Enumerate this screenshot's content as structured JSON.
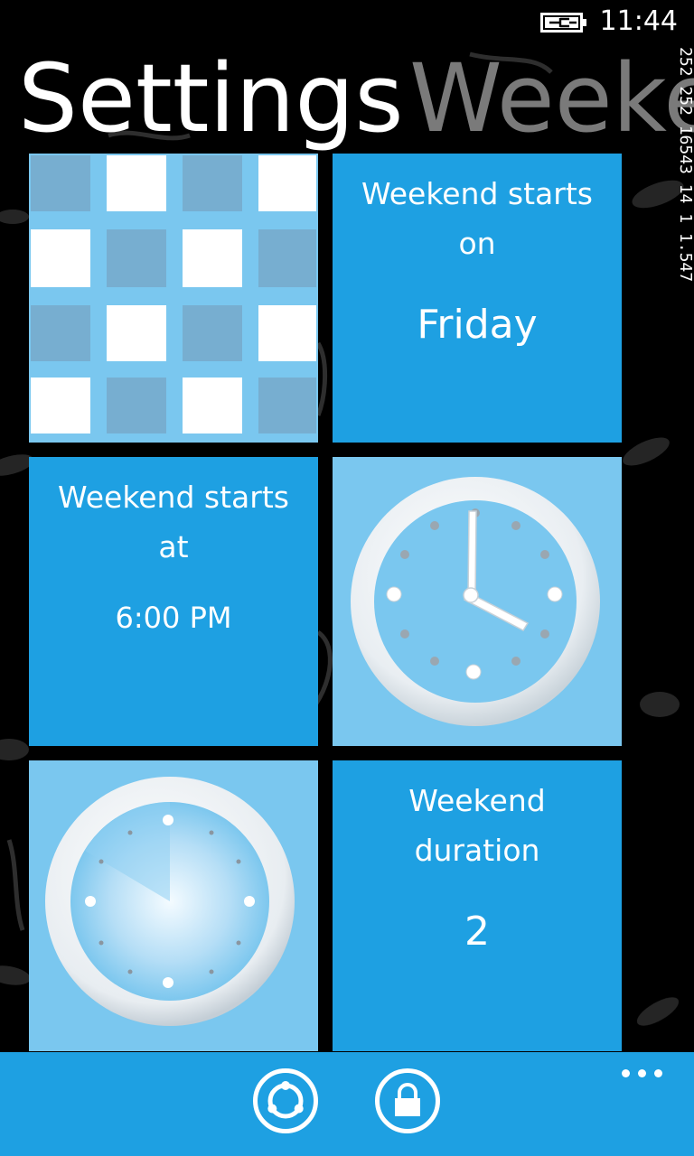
{
  "status_bar": {
    "time": "11:44",
    "battery_icon": "battery-charging-icon"
  },
  "title": "Settings",
  "next_section_title": "Weeke",
  "side_counter": "252 252 16543 14 1 1.547",
  "tiles": [
    {
      "id": "pattern",
      "icon": "checker-pattern-icon"
    },
    {
      "id": "start-day",
      "heading_line1": "Weekend starts",
      "heading_line2": "on",
      "value": "Friday"
    },
    {
      "id": "start-time",
      "heading_line1": "Weekend starts",
      "heading_line2": "at",
      "value": "6:00 PM"
    },
    {
      "id": "clock",
      "icon": "clock-icon"
    },
    {
      "id": "progress-clock",
      "icon": "progress-clock-icon"
    },
    {
      "id": "duration",
      "heading_line1": "Weekend",
      "heading_line2": "duration",
      "value": "2"
    }
  ],
  "app_bar": {
    "buttons": [
      {
        "icon": "sync-icon"
      },
      {
        "icon": "lock-icon"
      }
    ],
    "more_icon": "more-dots-icon"
  },
  "colors": {
    "tile_blue": "#1ea0e2",
    "tile_light": "#7ac7ef",
    "background": "#000000"
  }
}
